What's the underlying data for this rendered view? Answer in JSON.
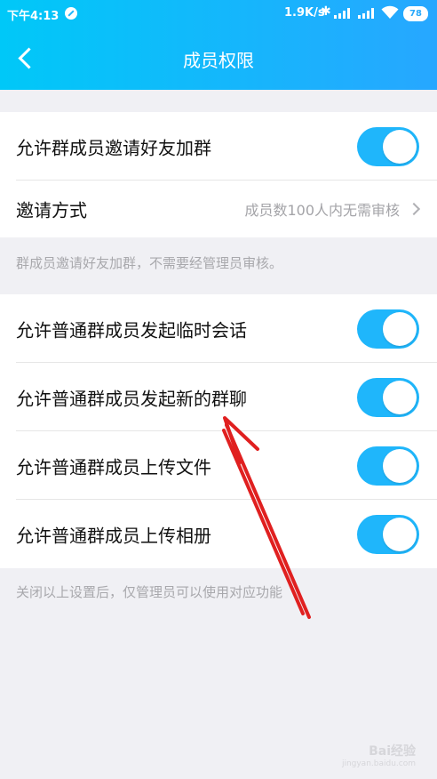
{
  "status_bar": {
    "time": "下午4:13",
    "network_speed": "1.9K/s",
    "battery": "78",
    "icons": [
      "do-not-disturb-icon",
      "bluetooth-icon",
      "signal-icon",
      "signal-icon",
      "wifi-icon",
      "battery-icon"
    ]
  },
  "header": {
    "title": "成员权限",
    "back_icon": "chevron-left-icon"
  },
  "invite_group": {
    "allow_invite_label": "允许群成员邀请好友加群",
    "allow_invite_on": true,
    "invite_method_label": "邀请方式",
    "invite_method_value": "成员数100人内无需审核",
    "hint": "群成员邀请好友加群，不需要经管理员审核。"
  },
  "member_group": {
    "items": [
      {
        "label": "允许普通群成员发起临时会话",
        "on": true
      },
      {
        "label": "允许普通群成员发起新的群聊",
        "on": true
      },
      {
        "label": "允许普通群成员上传文件",
        "on": true
      },
      {
        "label": "允许普通群成员上传相册",
        "on": true
      }
    ],
    "hint": "关闭以上设置后，仅管理员可以使用对应功能"
  },
  "watermark": {
    "brand": "Bai经验",
    "url": "jingyan.baidu.com"
  },
  "colors": {
    "accent": "#1fb6fb",
    "header_start": "#00c8f8",
    "header_end": "#27a7ff",
    "annotation": "#e02020"
  }
}
